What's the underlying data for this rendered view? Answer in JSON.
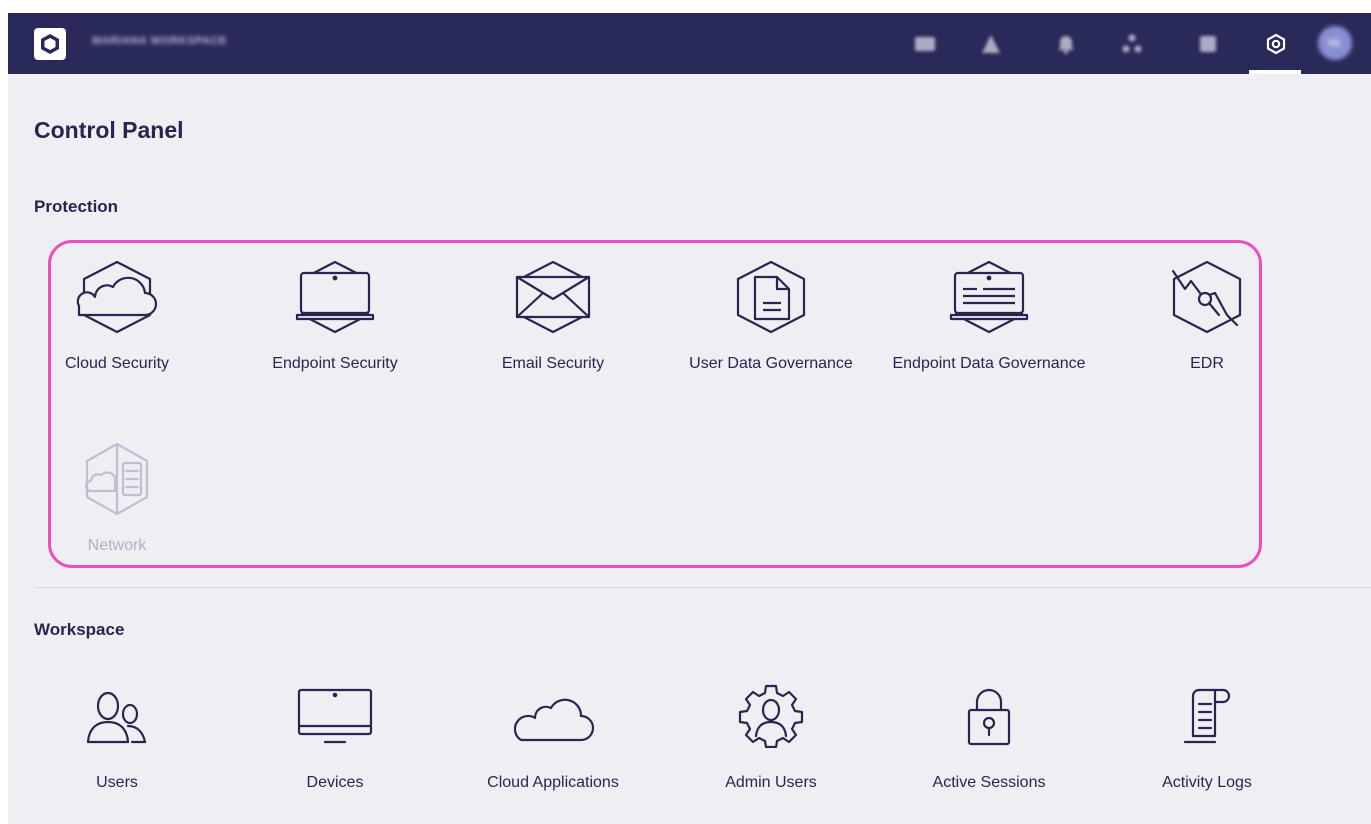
{
  "header": {
    "workspace_name": "MARIANA WORKSPACE",
    "avatar_initials": "ML",
    "icons": [
      "dashboard-icon",
      "alert-icon",
      "notification-icon",
      "network-icon",
      "reports-icon",
      "settings-icon"
    ]
  },
  "page": {
    "title": "Control Panel"
  },
  "protection": {
    "title": "Protection",
    "items": [
      {
        "label": "Cloud Security",
        "icon": "cloud-shield-icon"
      },
      {
        "label": "Endpoint Security",
        "icon": "laptop-shield-icon"
      },
      {
        "label": "Email Security",
        "icon": "envelope-shield-icon"
      },
      {
        "label": "User Data Governance",
        "icon": "document-shield-icon"
      },
      {
        "label": "Endpoint Data Governance",
        "icon": "monitor-data-shield-icon"
      },
      {
        "label": "EDR",
        "icon": "edr-shield-icon"
      },
      {
        "label": "Network",
        "icon": "network-cloud-server-icon",
        "disabled": true
      }
    ]
  },
  "workspace": {
    "title": "Workspace",
    "items": [
      {
        "label": "Users",
        "icon": "users-icon"
      },
      {
        "label": "Devices",
        "icon": "monitor-icon"
      },
      {
        "label": "Cloud Applications",
        "icon": "cloud-icon"
      },
      {
        "label": "Admin Users",
        "icon": "admin-gear-user-icon"
      },
      {
        "label": "Active Sessions",
        "icon": "padlock-icon"
      },
      {
        "label": "Activity Logs",
        "icon": "log-scroll-icon"
      }
    ]
  },
  "colors": {
    "topbar": "#2a2a5a",
    "text": "#2b2450",
    "icon_stroke": "#2b2450",
    "disabled": "#b3b0c6",
    "highlight": "#ee4dbe",
    "background": "#efeef3"
  }
}
